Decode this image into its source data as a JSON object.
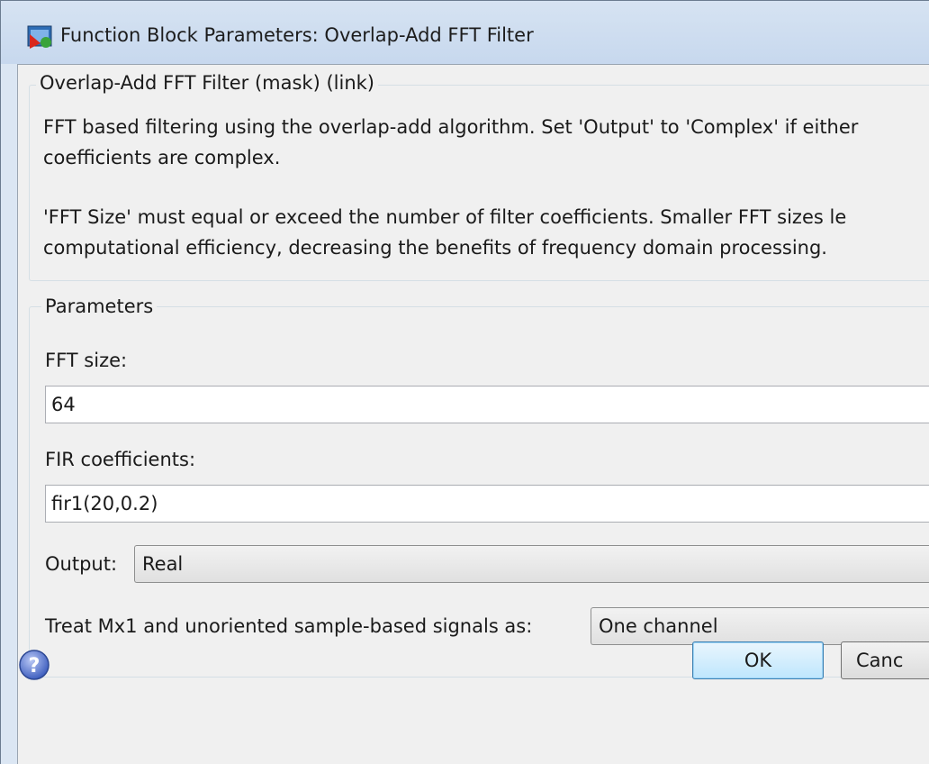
{
  "window": {
    "title": "Function Block Parameters: Overlap-Add FFT Filter"
  },
  "description_group": {
    "legend": "Overlap-Add FFT Filter (mask) (link)",
    "paragraph1_line1": "FFT based filtering using the overlap-add algorithm. Set 'Output' to 'Complex' if either",
    "paragraph1_line2": "coefficients are complex.",
    "paragraph2_line1": "'FFT Size' must equal or exceed the number of filter coefficients.  Smaller FFT sizes le",
    "paragraph2_line2": "computational efficiency, decreasing the benefits of frequency domain processing."
  },
  "parameters_group": {
    "legend": "Parameters",
    "fft_size": {
      "label": "FFT size:",
      "value": "64"
    },
    "fir_coefficients": {
      "label": "FIR coefficients:",
      "value": "fir1(20,0.2)"
    },
    "output": {
      "label": "Output:",
      "selected": "Real"
    },
    "treat_signals": {
      "label": "Treat Mx1 and unoriented sample-based signals as:",
      "selected": "One channel"
    }
  },
  "buttons": {
    "ok": "OK",
    "cancel": "Canc"
  },
  "icons": {
    "title_icon": "simulink-block-icon",
    "help_icon": "help-icon"
  }
}
